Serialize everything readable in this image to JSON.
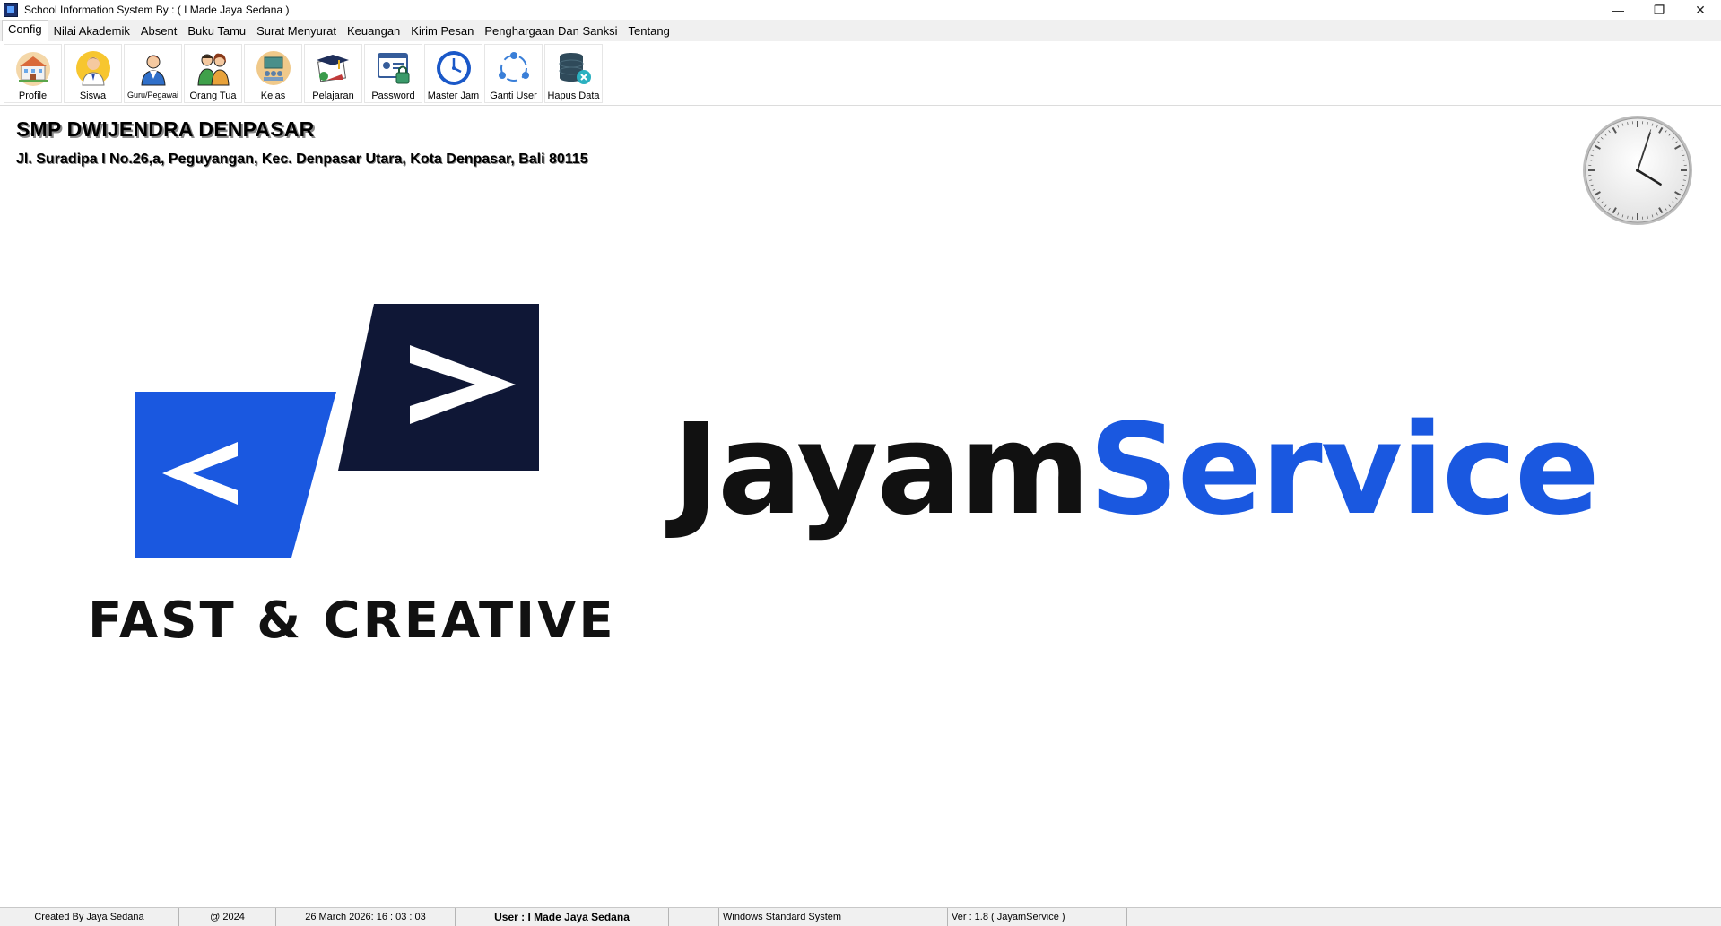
{
  "window": {
    "title": "School Information System By : ( I Made Jaya Sedana )",
    "controls": {
      "minimize": "—",
      "maximize": "❐",
      "close": "✕"
    }
  },
  "menu": {
    "tabs": [
      {
        "label": "Config",
        "active": true
      },
      {
        "label": "Nilai Akademik"
      },
      {
        "label": "Absent"
      },
      {
        "label": "Buku Tamu"
      },
      {
        "label": "Surat Menyurat"
      },
      {
        "label": "Keuangan"
      },
      {
        "label": "Kirim Pesan"
      },
      {
        "label": "Penghargaan Dan Sanksi"
      },
      {
        "label": "Tentang"
      }
    ]
  },
  "ribbon": {
    "buttons": [
      {
        "label": "Profile",
        "icon": "school-building-icon"
      },
      {
        "label": "Siswa",
        "icon": "student-icon"
      },
      {
        "label": "Guru/Pegawai",
        "icon": "teacher-icon"
      },
      {
        "label": "Orang Tua",
        "icon": "parents-icon"
      },
      {
        "label": "Kelas",
        "icon": "classroom-icon"
      },
      {
        "label": "Pelajaran",
        "icon": "lesson-icon"
      },
      {
        "label": "Password",
        "icon": "password-icon"
      },
      {
        "label": "Master Jam",
        "icon": "clock-icon"
      },
      {
        "label": "Ganti User",
        "icon": "switch-user-icon"
      },
      {
        "label": "Hapus Data",
        "icon": "delete-database-icon"
      }
    ]
  },
  "school": {
    "name": "SMP DWIJENDRA DENPASAR",
    "address": "Jl. Suradipa I No.26,a, Peguyangan, Kec. Denpasar Utara, Kota Denpasar, Bali 80115"
  },
  "clock": {
    "hour": 4,
    "minute": 3,
    "second": 3
  },
  "logo": {
    "tagline": "FAST & CREATIVE",
    "brand_part1": "Jayam",
    "brand_part2": "Service",
    "colors": {
      "blue": "#1a58e0",
      "navy": "#0f1736",
      "dark": "#111111"
    }
  },
  "status": {
    "created_by": "Created By Jaya Sedana",
    "year": "@ 2024",
    "datetime": "26 March 2026: 16 : 03 : 03",
    "user": "User : I Made Jaya Sedana",
    "theme": "Windows Standard System",
    "version": "Ver : 1.8 ( JayamService )"
  }
}
